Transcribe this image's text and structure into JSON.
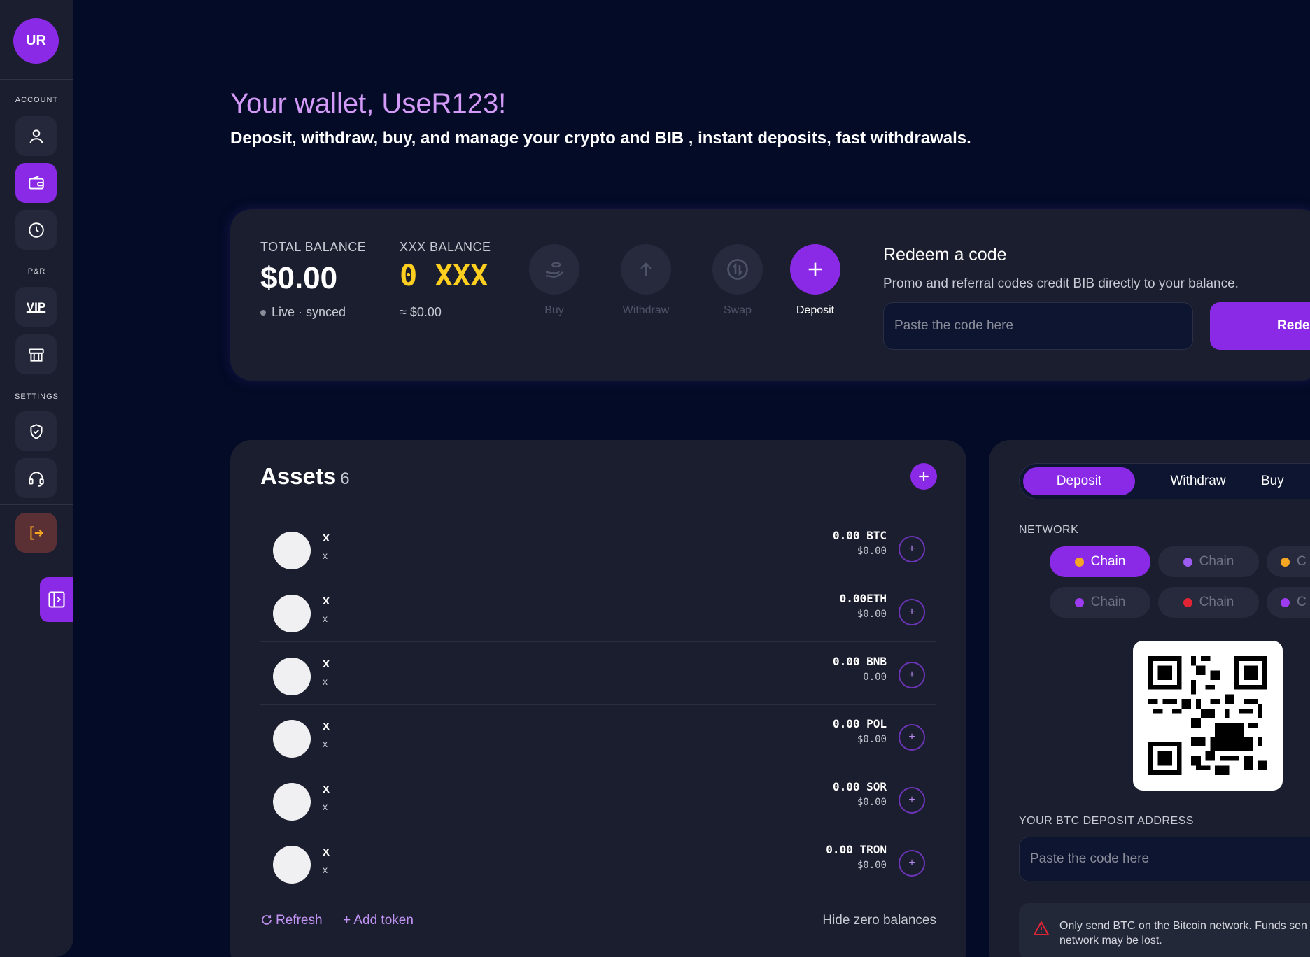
{
  "sidebar": {
    "avatar_initials": "UR",
    "sections": {
      "account": "ACCOUNT",
      "pr": "P&R",
      "settings": "SETTINGS"
    },
    "items": [
      {
        "icon": "user-icon",
        "active": false
      },
      {
        "icon": "wallet-icon",
        "active": true
      },
      {
        "icon": "clock-icon",
        "active": false
      },
      {
        "icon": "vip-icon",
        "active": false
      },
      {
        "icon": "gift-icon",
        "active": false
      },
      {
        "icon": "shield-icon",
        "active": false
      },
      {
        "icon": "headset-icon",
        "active": false
      },
      {
        "icon": "logout-icon",
        "active": false
      }
    ],
    "vip_label": "VIP"
  },
  "header": {
    "title": "Your wallet, UseR123!",
    "subtitle": "Deposit, withdraw, buy, and manage your crypto and BIB , instant deposits, fast withdrawals."
  },
  "balance": {
    "total_label": "TOTAL BALANCE",
    "total_value": "$0.00",
    "status": "Live · synced",
    "xxx_label": "XXX BALANCE",
    "xxx_value": "0 XXX",
    "xxx_approx": "≈ $0.00",
    "actions": [
      {
        "label": "Buy",
        "enabled": false
      },
      {
        "label": "Withdraw",
        "enabled": false
      },
      {
        "label": "Swap",
        "enabled": false
      },
      {
        "label": "Deposit",
        "enabled": true
      }
    ]
  },
  "redeem": {
    "title": "Redeem a code",
    "description": "Promo and referral codes credit BIB directly to your balance.",
    "placeholder": "Paste the code here",
    "button_label": "Rede"
  },
  "assets": {
    "title": "Assets",
    "count": "6",
    "rows": [
      {
        "name": "x",
        "sub": "x",
        "amount": "0.00 BTC",
        "usd": "$0.00"
      },
      {
        "name": "x",
        "sub": "x",
        "amount": "0.00ETH",
        "usd": "$0.00"
      },
      {
        "name": "x",
        "sub": "x",
        "amount": "0.00 BNB",
        "usd": "0.00"
      },
      {
        "name": "x",
        "sub": "x",
        "amount": "0.00 POL",
        "usd": "$0.00"
      },
      {
        "name": "x",
        "sub": "x",
        "amount": "0.00 SOR",
        "usd": "$0.00"
      },
      {
        "name": "x",
        "sub": "x",
        "amount": "0.00 TRON",
        "usd": "$0.00"
      }
    ],
    "refresh_label": "Refresh",
    "add_token_label": "+ Add token",
    "hide_zero_label": "Hide zero balances"
  },
  "deposit_panel": {
    "tabs": [
      "Deposit",
      "Withdraw",
      "Buy"
    ],
    "network_label": "NETWORK",
    "chips": [
      {
        "label": "Chain",
        "color": "#f5a623",
        "active": true
      },
      {
        "label": "Chain",
        "color": "#9d5cf0",
        "active": false
      },
      {
        "label": "C",
        "color": "#f5a623",
        "active": false
      },
      {
        "label": "Chain",
        "color": "#9d3bf0",
        "active": false
      },
      {
        "label": "Chain",
        "color": "#e02434",
        "active": false
      },
      {
        "label": "C",
        "color": "#9d3bf0",
        "active": false
      }
    ],
    "address_label": "YOUR BTC DEPOSIT ADDRESS",
    "address_placeholder": "Paste the code here",
    "warning": "Only send BTC on the Bitcoin network. Funds sen network may be lost."
  },
  "colors": {
    "background": "#030b26",
    "card": "#1b1e2e",
    "accent": "#8b2ae6",
    "title": "#d39af8",
    "xxx_yellow": "#ffcf1f"
  }
}
